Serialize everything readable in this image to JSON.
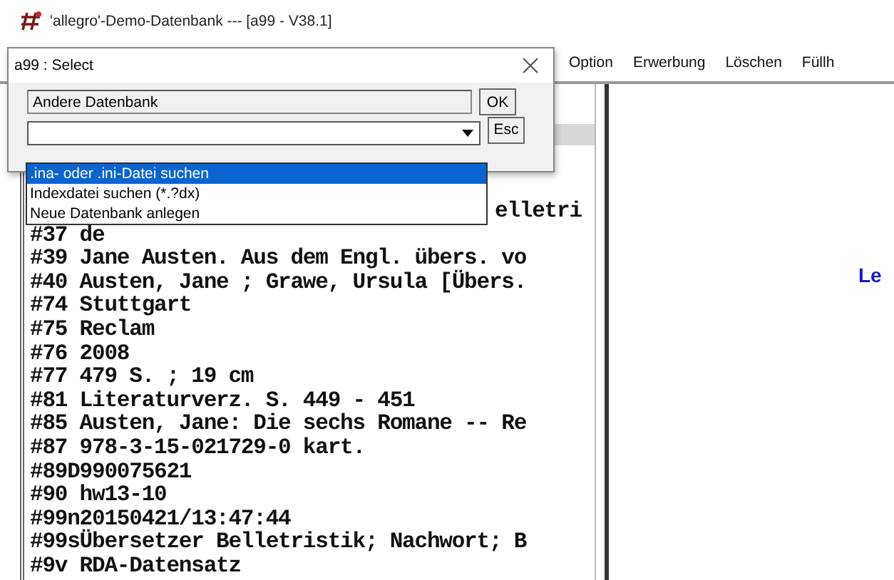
{
  "window": {
    "title": "'allegro'-Demo-Datenbank --- [a99 - V38.1]"
  },
  "menu": [
    "Option",
    "Erwerbung",
    "Löschen",
    "Füllh"
  ],
  "record": {
    "lines": [
      {
        "kind": "fragment",
        "text": "elletri"
      },
      {
        "kind": "line",
        "text": "#37 de"
      },
      {
        "kind": "line",
        "text": "#39 Jane Austen. Aus dem Engl. übers. vo"
      },
      {
        "kind": "line",
        "text": "#40 Austen, Jane ; Grawe, Ursula [Übers."
      },
      {
        "kind": "line",
        "text": "#74 Stuttgart"
      },
      {
        "kind": "line",
        "text": "#75 Reclam"
      },
      {
        "kind": "line",
        "text": "#76 2008"
      },
      {
        "kind": "line",
        "text": "#77 479 S. ; 19 cm"
      },
      {
        "kind": "line",
        "text": "#81 Literaturverz. S. 449 - 451"
      },
      {
        "kind": "line",
        "text": "#85 Austen, Jane: Die sechs Romane -- Re"
      },
      {
        "kind": "line",
        "text": "#87 978-3-15-021729-0 kart."
      },
      {
        "kind": "line",
        "text": "#89D990075621"
      },
      {
        "kind": "line",
        "text": "#90 hw13-10"
      },
      {
        "kind": "line",
        "text": "#99n20150421/13:47:44"
      },
      {
        "kind": "line",
        "text": "#99sÜbersetzer Belletristik; Nachwort; B"
      },
      {
        "kind": "line",
        "text": "#9v RDA-Datensatz"
      }
    ]
  },
  "right_pane": {
    "heading": "Le"
  },
  "dialog": {
    "title": "a99 : Select",
    "name_field": {
      "value": "Andere Datenbank"
    },
    "ok_button": "OK",
    "esc_button": "Esc",
    "dropdown": {
      "options": [
        {
          "label": ".ina- oder .ini-Datei suchen",
          "selected": true
        },
        {
          "label": "Indexdatei suchen (*.?dx)",
          "selected": false
        },
        {
          "label": "Neue Datenbank anlegen",
          "selected": false
        }
      ]
    }
  }
}
